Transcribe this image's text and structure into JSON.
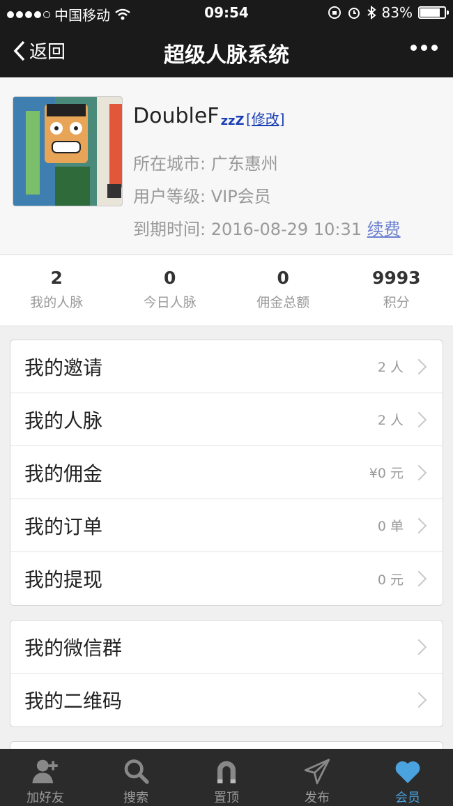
{
  "status_bar": {
    "carrier": "中国移动",
    "time": "09:54",
    "battery": "83%",
    "battery_level": 0.83
  },
  "nav": {
    "back_label": "返回",
    "title": "超级人脉系统"
  },
  "profile": {
    "name": "DoubleF",
    "name_suffix": "zzZ",
    "edit_label": "[修改]",
    "city": "所在城市: 广东惠州",
    "level": "用户等级: VIP会员",
    "expiry": "到期时间: 2016-08-29 10:31",
    "renew_label": "续费"
  },
  "stats": [
    {
      "value": "2",
      "label": "我的人脉"
    },
    {
      "value": "0",
      "label": "今日人脉"
    },
    {
      "value": "0",
      "label": "佣金总额"
    },
    {
      "value": "9993",
      "label": "积分"
    }
  ],
  "menu_group_1": [
    {
      "label": "我的邀请",
      "value": "2 人"
    },
    {
      "label": "我的人脉",
      "value": "2 人"
    },
    {
      "label": "我的佣金",
      "value": "¥0 元"
    },
    {
      "label": "我的订单",
      "value": "0 单"
    },
    {
      "label": "我的提现",
      "value": "0 元"
    }
  ],
  "menu_group_2": [
    {
      "label": "我的微信群",
      "value": ""
    },
    {
      "label": "我的二维码",
      "value": ""
    }
  ],
  "tabbar": [
    {
      "label": "加好友",
      "icon": "add-friend-icon"
    },
    {
      "label": "搜索",
      "icon": "search-icon"
    },
    {
      "label": "置顶",
      "icon": "magnet-icon"
    },
    {
      "label": "发布",
      "icon": "paper-plane-icon"
    },
    {
      "label": "会员",
      "icon": "heart-icon"
    }
  ],
  "colors": {
    "bar": "#1a1a1a",
    "tab_active": "#4aa3df",
    "link": "#1b3fb5"
  }
}
